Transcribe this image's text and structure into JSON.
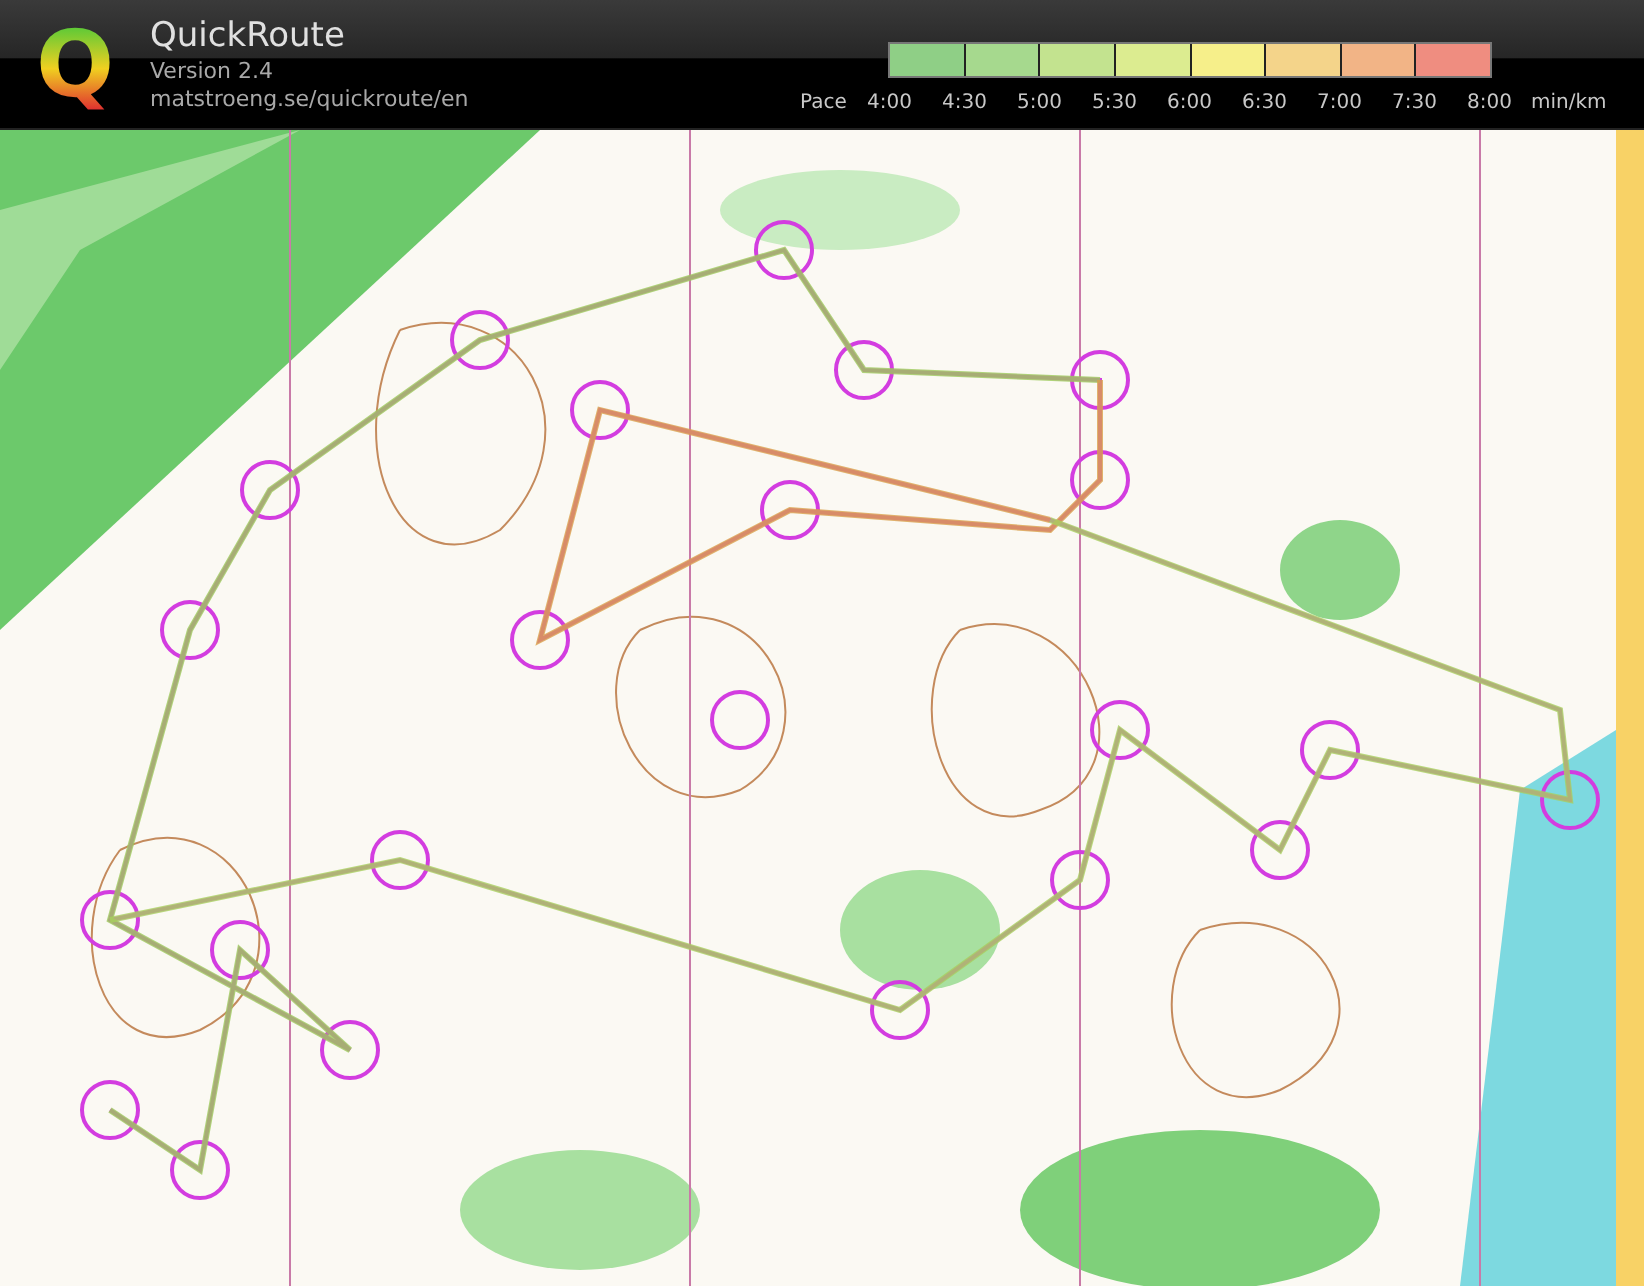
{
  "app": {
    "logo": "Q",
    "title": "QuickRoute",
    "version": "Version 2.4",
    "url": "matstroeng.se/quickroute/en"
  },
  "pace_legend": {
    "label": "Pace",
    "ticks": [
      "4:00",
      "4:30",
      "5:00",
      "5:30",
      "6:00",
      "6:30",
      "7:00",
      "7:30",
      "8:00"
    ],
    "unit": "min/km"
  }
}
